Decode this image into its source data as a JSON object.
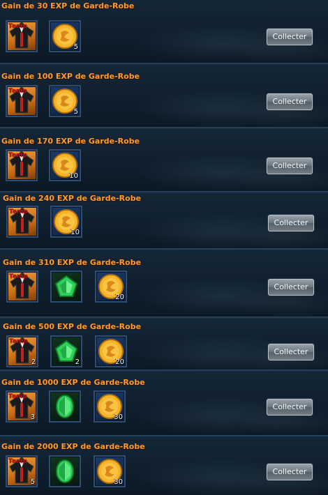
{
  "rewards": [
    {
      "title": "Gain de 30 EXP de Garde-Robe",
      "button": "Collecter",
      "items": [
        {
          "icon": "outfit-icon",
          "badge": "Temp",
          "qty": ""
        },
        {
          "icon": "gold-coin-icon",
          "qty": "5"
        }
      ]
    },
    {
      "title": "Gain de 100 EXP de Garde-Robe",
      "button": "Collecter",
      "items": [
        {
          "icon": "outfit-icon",
          "badge": "Temp",
          "qty": ""
        },
        {
          "icon": "gold-coin-icon",
          "qty": "5"
        }
      ]
    },
    {
      "title": "Gain de 170 EXP de Garde-Robe",
      "button": "Collecter",
      "items": [
        {
          "icon": "outfit-icon",
          "badge": "Temp",
          "qty": ""
        },
        {
          "icon": "gold-coin-icon",
          "qty": "10"
        }
      ]
    },
    {
      "title": "Gain de 240 EXP de Garde-Robe",
      "button": "Collecter",
      "items": [
        {
          "icon": "outfit-icon",
          "badge": "Temp",
          "qty": ""
        },
        {
          "icon": "gold-coin-icon",
          "qty": "10"
        }
      ]
    },
    {
      "title": "Gain de 310 EXP de Garde-Robe",
      "button": "Collecter",
      "items": [
        {
          "icon": "outfit-icon",
          "badge": "Temp",
          "qty": ""
        },
        {
          "icon": "green-pentagon-gem-icon",
          "qty": ""
        },
        {
          "icon": "gold-coin-icon",
          "qty": "20"
        }
      ]
    },
    {
      "title": "Gain de 500 EXP de Garde-Robe",
      "button": "Collecter",
      "items": [
        {
          "icon": "outfit-icon",
          "badge": "Temp",
          "qty": "2"
        },
        {
          "icon": "green-pentagon-gem-icon",
          "qty": "2"
        },
        {
          "icon": "gold-coin-icon",
          "qty": "20"
        }
      ]
    },
    {
      "title": "Gain de 1000 EXP de Garde-Robe",
      "button": "Collecter",
      "items": [
        {
          "icon": "outfit-icon",
          "badge": "Temp",
          "qty": "3"
        },
        {
          "icon": "green-oval-gem-icon",
          "qty": ""
        },
        {
          "icon": "gold-coin-icon",
          "qty": "30"
        }
      ]
    },
    {
      "title": "Gain de 2000 EXP de Garde-Robe",
      "button": "Collecter",
      "items": [
        {
          "icon": "outfit-icon",
          "badge": "Temp",
          "qty": "5"
        },
        {
          "icon": "green-oval-gem-icon",
          "qty": ""
        },
        {
          "icon": "gold-coin-icon",
          "qty": "30"
        }
      ]
    }
  ],
  "colors": {
    "title": "#ff9a2c",
    "temp_badge": "#c81010",
    "button_text": "#f4f6f7"
  }
}
